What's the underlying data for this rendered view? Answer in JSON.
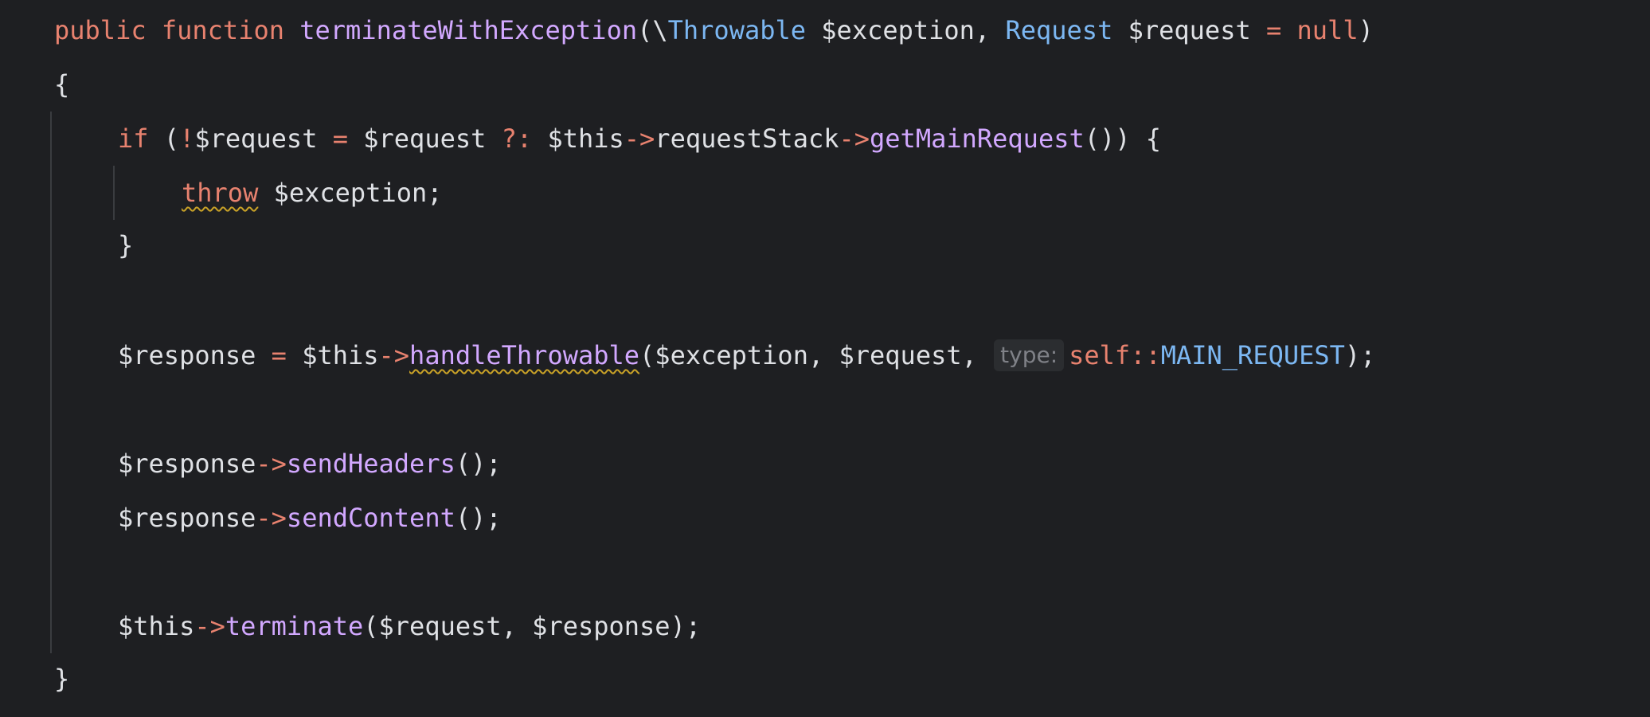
{
  "editor": {
    "background": "#1e1f22",
    "colors": {
      "keyword": "#e8826f",
      "function": "#d2a8ff",
      "type": "#7cb7f2",
      "plain": "#dfe1e5"
    },
    "line1": {
      "kw_public": "public",
      "kw_function": "function",
      "fn_name": "terminateWithException",
      "paren_open": "(",
      "backslash": "\\",
      "type_throwable": "Throwable",
      "param_exception": " $exception, ",
      "type_request": "Request",
      "param_request": " $request ",
      "eq": "=",
      "null": "null",
      "paren_close": ")"
    },
    "line2": {
      "brace_open": "{"
    },
    "line3": {
      "kw_if": "if",
      "paren": " (",
      "not": "!",
      "var_request": "$request ",
      "eq": "=",
      "var_request2": " $request ",
      "elvis": "?:",
      "this": " $this",
      "arrow1": "->",
      "request_stack": "requestStack",
      "arrow2": "->",
      "get_main_request": "getMainRequest",
      "tail": "()) {"
    },
    "line4": {
      "kw_throw": "throw",
      "tail": " $exception;"
    },
    "line5": {
      "brace_close": "}"
    },
    "line6": {
      "var_response": "$response ",
      "eq": "=",
      "this": " $this",
      "arrow": "->",
      "handle_throwable": "handleThrowable",
      "args": "($exception, $request, ",
      "hint": "type:",
      "self": "self",
      "double_colon": "::",
      "const_main_request": "MAIN_REQUEST",
      "tail": ");"
    },
    "line7": {
      "var_response": "$response",
      "arrow": "->",
      "send_headers": "sendHeaders",
      "tail": "();"
    },
    "line8": {
      "var_response": "$response",
      "arrow": "->",
      "send_content": "sendContent",
      "tail": "();"
    },
    "line9": {
      "this": "$this",
      "arrow": "->",
      "terminate": "terminate",
      "tail": "($request, $response);"
    },
    "line10": {
      "brace_close": "}"
    }
  }
}
